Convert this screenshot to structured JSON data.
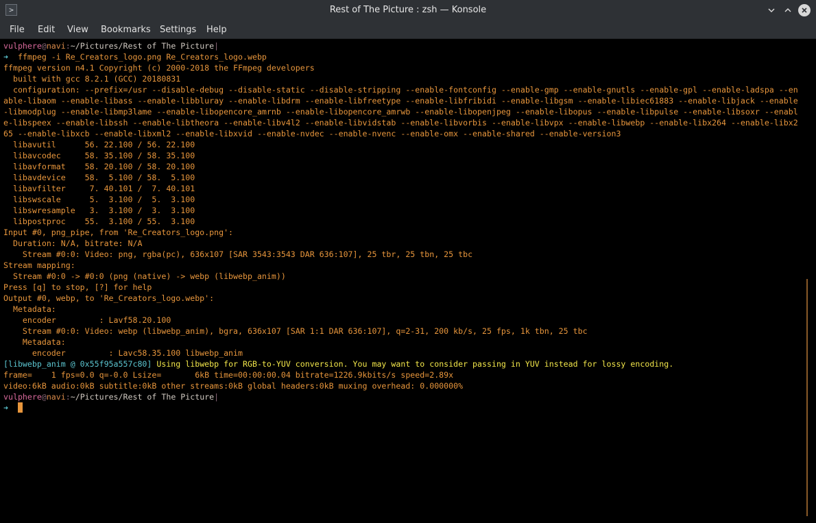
{
  "window": {
    "title": "Rest of The Picture : zsh — Konsole",
    "icon": "terminal-app-icon",
    "buttons": [
      "chevron-down-icon",
      "chevron-up-icon",
      "close-icon"
    ]
  },
  "menubar": {
    "items": [
      "File",
      "Edit",
      "View",
      "Bookmarks",
      "Settings",
      "Help"
    ]
  },
  "prompt": {
    "user": "vulphere",
    "at": "@",
    "host": "navi",
    "colon": ":",
    "path": "~/Pictures/Rest of The Picture",
    "bar": "|",
    "arrow": "➜"
  },
  "terminal": {
    "command": "  ffmpeg -i Re_Creators_logo.png Re_Creators_logo.webp",
    "output": [
      "ffmpeg version n4.1 Copyright (c) 2000-2018 the FFmpeg developers",
      "  built with gcc 8.2.1 (GCC) 20180831",
      "  configuration: --prefix=/usr --disable-debug --disable-static --disable-stripping --enable-fontconfig --enable-gmp --enable-gnutls --enable-gpl --enable-ladspa --en",
      "able-libaom --enable-libass --enable-libbluray --enable-libdrm --enable-libfreetype --enable-libfribidi --enable-libgsm --enable-libiec61883 --enable-libjack --enable",
      "-libmodplug --enable-libmp3lame --enable-libopencore_amrnb --enable-libopencore_amrwb --enable-libopenjpeg --enable-libopus --enable-libpulse --enable-libsoxr --enabl",
      "e-libspeex --enable-libssh --enable-libtheora --enable-libv4l2 --enable-libvidstab --enable-libvorbis --enable-libvpx --enable-libwebp --enable-libx264 --enable-libx2",
      "65 --enable-libxcb --enable-libxml2 --enable-libxvid --enable-nvdec --enable-nvenc --enable-omx --enable-shared --enable-version3",
      "  libavutil      56. 22.100 / 56. 22.100",
      "  libavcodec     58. 35.100 / 58. 35.100",
      "  libavformat    58. 20.100 / 58. 20.100",
      "  libavdevice    58.  5.100 / 58.  5.100",
      "  libavfilter     7. 40.101 /  7. 40.101",
      "  libswscale      5.  3.100 /  5.  3.100",
      "  libswresample   3.  3.100 /  3.  3.100",
      "  libpostproc    55.  3.100 / 55.  3.100",
      "Input #0, png_pipe, from 'Re_Creators_logo.png':",
      "  Duration: N/A, bitrate: N/A",
      "    Stream #0:0: Video: png, rgba(pc), 636x107 [SAR 3543:3543 DAR 636:107], 25 tbr, 25 tbn, 25 tbc",
      "Stream mapping:",
      "  Stream #0:0 -> #0:0 (png (native) -> webp (libwebp_anim))",
      "Press [q] to stop, [?] for help",
      "Output #0, webp, to 'Re_Creators_logo.webp':",
      "  Metadata:",
      "    encoder         : Lavf58.20.100",
      "    Stream #0:0: Video: webp (libwebp_anim), bgra, 636x107 [SAR 1:1 DAR 636:107], q=2-31, 200 kb/s, 25 fps, 1k tbn, 25 tbc",
      "    Metadata:",
      "      encoder         : Lavc58.35.100 libwebp_anim"
    ],
    "warning_tag": "[libwebp_anim @ 0x55f95a557c80]",
    "warning_text": " Using libwebp for RGB-to-YUV conversion. You may want to consider passing in YUV instead for lossy encoding.",
    "progress_line": "frame=    1 fps=0.0 q=-0.0 Lsize=       6kB time=00:00:00.04 bitrate=1226.9kbits/s speed=2.89x",
    "summary_line": "video:6kB audio:0kB subtitle:0kB other streams:0kB global headers:0kB muxing overhead: 0.000000%"
  },
  "colors": {
    "background": "#000000",
    "chrome": "#2e3135",
    "output_text": "#e8963c",
    "username": "#d96a9c",
    "prompt_arrow": "#5cc6d1",
    "warning": "#f2e64a"
  }
}
